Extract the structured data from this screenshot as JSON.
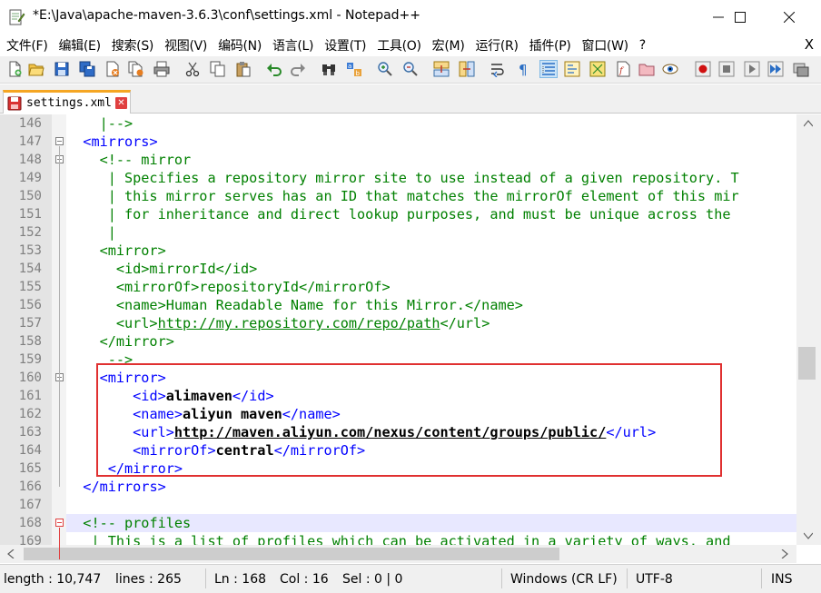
{
  "window": {
    "title": "*E:\\Java\\apache-maven-3.6.3\\conf\\settings.xml - Notepad++",
    "minimize": "—",
    "maximize": "☐",
    "close": "✕"
  },
  "menu": {
    "items": [
      {
        "label": "文件(F)"
      },
      {
        "label": "编辑(E)"
      },
      {
        "label": "搜索(S)"
      },
      {
        "label": "视图(V)"
      },
      {
        "label": "编码(N)"
      },
      {
        "label": "语言(L)"
      },
      {
        "label": "设置(T)"
      },
      {
        "label": "工具(O)"
      },
      {
        "label": "宏(M)"
      },
      {
        "label": "运行(R)"
      },
      {
        "label": "插件(P)"
      },
      {
        "label": "窗口(W)"
      },
      {
        "label": "?"
      }
    ],
    "close_label": "X"
  },
  "toolbar": {
    "icons": [
      "new-file-icon",
      "open-file-icon",
      "save-icon",
      "save-all-icon",
      "close-icon",
      "close-all-icon",
      "print-icon",
      "cut-icon",
      "copy-icon",
      "paste-icon",
      "undo-icon",
      "redo-icon",
      "find-icon",
      "replace-icon",
      "zoom-in-icon",
      "zoom-out-icon",
      "sync-vertical-icon",
      "sync-horizontal-icon",
      "word-wrap-icon",
      "show-all-chars-icon",
      "indent-guide-icon",
      "udl-icon",
      "doc-map-icon",
      "function-list-icon",
      "folder-workspace-icon",
      "monitor-icon",
      "record-macro-icon",
      "stop-macro-icon",
      "play-macro-icon",
      "run-macro-multiple-icon",
      "save-macro-icon"
    ]
  },
  "tab": {
    "label": "settings.xml",
    "close": "✕"
  },
  "editor": {
    "lines": [
      {
        "num": "146",
        "tokens": [
          {
            "t": "    |-->",
            "c": "comment"
          }
        ]
      },
      {
        "num": "147",
        "tokens": [
          {
            "t": "  ",
            "c": "plain"
          },
          {
            "t": "<mirrors>",
            "c": "tag"
          }
        ]
      },
      {
        "num": "148",
        "tokens": [
          {
            "t": "    ",
            "c": "plain"
          },
          {
            "t": "<!-- mirror",
            "c": "comment"
          }
        ]
      },
      {
        "num": "149",
        "tokens": [
          {
            "t": "     | Specifies a repository mirror site to use instead of a given repository. T",
            "c": "comment"
          }
        ]
      },
      {
        "num": "150",
        "tokens": [
          {
            "t": "     | this mirror serves has an ID that matches the mirrorOf element of this mir",
            "c": "comment"
          }
        ]
      },
      {
        "num": "151",
        "tokens": [
          {
            "t": "     | for inheritance and direct lookup purposes, and must be unique across the ",
            "c": "comment"
          }
        ]
      },
      {
        "num": "152",
        "tokens": [
          {
            "t": "     |",
            "c": "comment"
          }
        ]
      },
      {
        "num": "153",
        "tokens": [
          {
            "t": "    <mirror>",
            "c": "comment"
          }
        ]
      },
      {
        "num": "154",
        "tokens": [
          {
            "t": "      <id>mirrorId</id>",
            "c": "comment"
          }
        ]
      },
      {
        "num": "155",
        "tokens": [
          {
            "t": "      <mirrorOf>repositoryId</mirrorOf>",
            "c": "comment"
          }
        ]
      },
      {
        "num": "156",
        "tokens": [
          {
            "t": "      <name>Human Readable Name for this Mirror.</name>",
            "c": "comment"
          }
        ]
      },
      {
        "num": "157",
        "tokens": [
          {
            "t": "      <url>",
            "c": "comment"
          },
          {
            "t": "http://my.repository.com/repo/path",
            "c": "comment-link"
          },
          {
            "t": "</url>",
            "c": "comment"
          }
        ]
      },
      {
        "num": "158",
        "tokens": [
          {
            "t": "    </mirror>",
            "c": "comment"
          }
        ]
      },
      {
        "num": "159",
        "tokens": [
          {
            "t": "     -->",
            "c": "comment"
          }
        ]
      },
      {
        "num": "160",
        "tokens": [
          {
            "t": "    ",
            "c": "plain"
          },
          {
            "t": "<mirror>",
            "c": "tag"
          }
        ]
      },
      {
        "num": "161",
        "tokens": [
          {
            "t": "        ",
            "c": "plain"
          },
          {
            "t": "<id>",
            "c": "tag"
          },
          {
            "t": "alimaven",
            "c": "bold"
          },
          {
            "t": "</id>",
            "c": "tag"
          }
        ]
      },
      {
        "num": "162",
        "tokens": [
          {
            "t": "        ",
            "c": "plain"
          },
          {
            "t": "<name>",
            "c": "tag"
          },
          {
            "t": "aliyun maven",
            "c": "bold"
          },
          {
            "t": "</name>",
            "c": "tag"
          }
        ]
      },
      {
        "num": "163",
        "tokens": [
          {
            "t": "        ",
            "c": "plain"
          },
          {
            "t": "<url>",
            "c": "tag"
          },
          {
            "t": "http://maven.aliyun.com/nexus/content/groups/public/",
            "c": "link-bold"
          },
          {
            "t": "</url>",
            "c": "tag"
          }
        ]
      },
      {
        "num": "164",
        "tokens": [
          {
            "t": "        ",
            "c": "plain"
          },
          {
            "t": "<mirrorOf>",
            "c": "tag"
          },
          {
            "t": "central",
            "c": "bold"
          },
          {
            "t": "</mirrorOf>",
            "c": "tag"
          }
        ]
      },
      {
        "num": "165",
        "tokens": [
          {
            "t": "    ",
            "c": "plain"
          },
          {
            "t": " </mirror>",
            "c": "tag"
          }
        ]
      },
      {
        "num": "166",
        "tokens": [
          {
            "t": "  ",
            "c": "plain"
          },
          {
            "t": "</mirrors>",
            "c": "tag"
          }
        ]
      },
      {
        "num": "167",
        "tokens": []
      },
      {
        "num": "168",
        "tokens": [
          {
            "t": "  ",
            "c": "plain"
          },
          {
            "t": "<!-- profiles",
            "c": "comment"
          }
        ]
      },
      {
        "num": "169",
        "tokens": [
          {
            "t": "   | This is a list of profiles which can be activated in a variety of ways, and",
            "c": "comment"
          }
        ]
      }
    ],
    "current_line": "168"
  },
  "status": {
    "length": "length : 10,747",
    "lines": "lines : 265",
    "ln": "Ln : 168",
    "col": "Col : 16",
    "sel": "Sel : 0 | 0",
    "eol": "Windows (CR LF)",
    "encoding": "UTF-8",
    "mode": "INS"
  }
}
